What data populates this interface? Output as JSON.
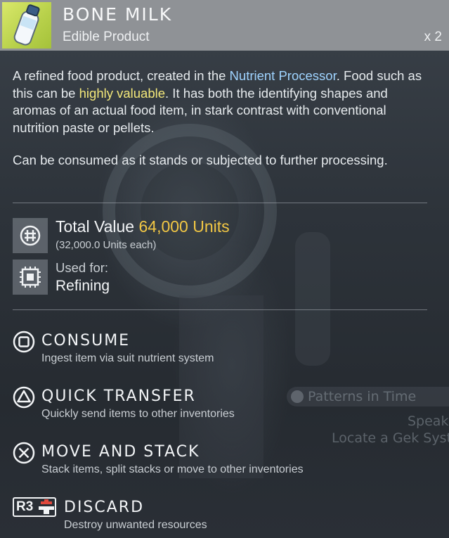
{
  "item": {
    "name": "BONE MILK",
    "category": "Edible Product",
    "quantity": "x 2",
    "icon": "bone-milk-bottle-icon"
  },
  "description": {
    "p1_a": "A refined food product, created in the ",
    "p1_link": "Nutrient Processor",
    "p1_b": ". Food such as this can be ",
    "p1_highlight": "highly valuable",
    "p1_c": ". It has both the identifying shapes and aromas of an actual food item, in stark contrast with conventional nutrition paste or pellets.",
    "p2": "Can be consumed as it stands or subjected to further processing."
  },
  "stats": {
    "value_label": "Total Value ",
    "value_amount": "64,000 Units",
    "value_each": "(32,000.0 Units each)",
    "used_label": "Used for:",
    "used_value": "Refining"
  },
  "actions": [
    {
      "title": "CONSUME",
      "desc": "Ingest item via suit nutrient system",
      "button": "square-button-icon"
    },
    {
      "title": "QUICK TRANSFER",
      "desc": "Quickly send items to other inventories",
      "button": "triangle-button-icon"
    },
    {
      "title": "MOVE AND STACK",
      "desc": "Stack items, split stacks or move to other inventories",
      "button": "cross-button-icon"
    },
    {
      "title": "DISCARD",
      "desc": "Destroy unwanted resources",
      "button": "r3-button-icon",
      "button_text": "R3"
    }
  ],
  "background_hud": {
    "mission": "Patterns in Time",
    "speak": "Speak",
    "locate": "Locate a Gek Syst"
  },
  "colors": {
    "header_bg": "#8f9296",
    "link_blue": "#9fd3ff",
    "highlight_yellow": "#f4e87a",
    "value_gold": "#f2c744"
  }
}
